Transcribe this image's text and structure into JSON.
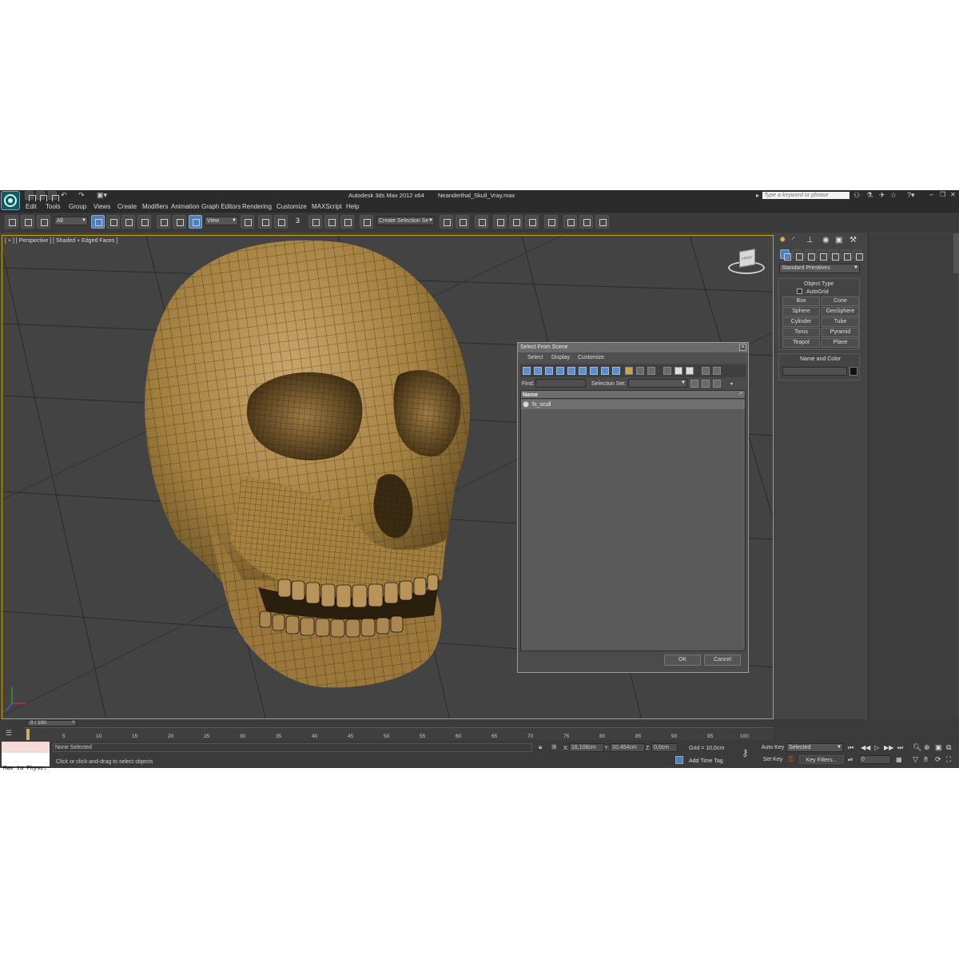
{
  "window": {
    "title": "Autodesk 3ds Max  2012 x64",
    "file": "Neanderthal_Skull_Vray.max",
    "search_placeholder": "Type a keyword or phrase"
  },
  "menu": [
    "Edit",
    "Tools",
    "Group",
    "Views",
    "Create",
    "Modifiers",
    "Animation",
    "Graph Editors",
    "Rendering",
    "Customize",
    "MAXScript",
    "Help"
  ],
  "toolbar": {
    "filter": "All",
    "coord": "View",
    "selection_set": "Create Selection Se",
    "snap_label": "3"
  },
  "viewport": {
    "label": "[ + ] [ Perspective ] [ Shaded + Edged Faces ]",
    "viewcube_label": "FRONT"
  },
  "command_panel": {
    "category": "Standard Primitives",
    "object_type_title": "Object Type",
    "autogrid": "AutoGrid",
    "buttons": [
      "Box",
      "Cone",
      "Sphere",
      "GeoSphere",
      "Cylinder",
      "Tube",
      "Torus",
      "Pyramid",
      "Teapot",
      "Plane"
    ],
    "name_color_title": "Name and Color",
    "swatch_color": "#111111"
  },
  "dialog": {
    "title": "Select From Scene",
    "menu": [
      "Select",
      "Display",
      "Customize"
    ],
    "find_label": "Find:",
    "selection_set_label": "Selection Set:",
    "column": "Name",
    "items": [
      "fs_scull"
    ],
    "ok": "OK",
    "cancel": "Cancel"
  },
  "timeline": {
    "frame": "0 / 100",
    "ticks": [
      "0",
      "5",
      "10",
      "15",
      "20",
      "25",
      "30",
      "35",
      "40",
      "45",
      "50",
      "55",
      "60",
      "65",
      "70",
      "75",
      "80",
      "85",
      "90",
      "95",
      "100"
    ]
  },
  "status": {
    "maxscript": "Max to Physc.",
    "selection": "None Selected",
    "prompt": "Click or click-and-drag to select objects",
    "x_label": "X:",
    "x": "16,108cm",
    "y_label": "Y:",
    "y": "10,454cm",
    "z_label": "Z:",
    "z": "0,0cm",
    "grid": "Grid = 10,0cm",
    "add_time_tag": "Add Time Tag",
    "auto_key": "Auto Key",
    "set_key": "Set Key",
    "key_mode": "Selected",
    "key_filters": "Key Filters...",
    "frame_field": "0"
  },
  "colors": {
    "viewport_border": "#c9a300",
    "active_button": "#4f7fbf",
    "autokey_highlight": "#b23a3a"
  }
}
